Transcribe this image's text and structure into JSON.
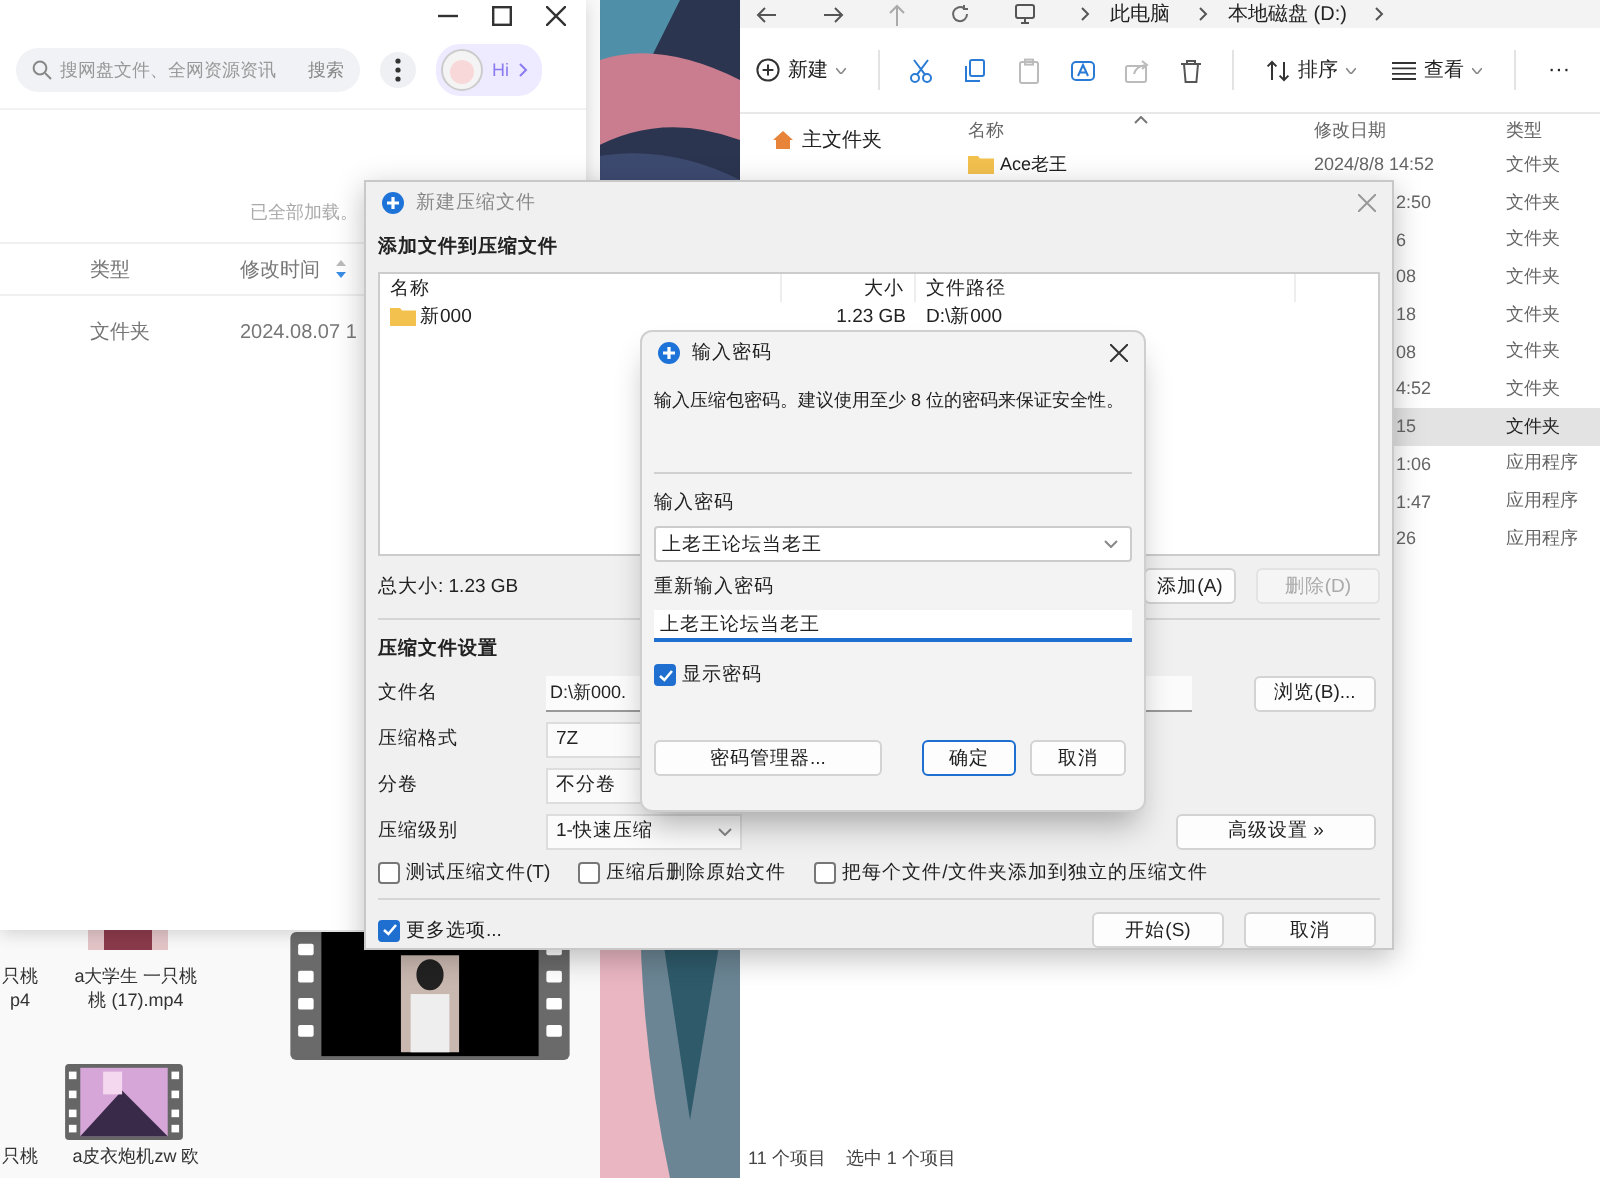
{
  "cloud_app": {
    "search": {
      "placeholder": "搜网盘文件、全网资源资讯",
      "button": "搜索"
    },
    "assistant_label": "Hi",
    "load_status": "已全部加载。",
    "columns": [
      "类型",
      "修改时间"
    ],
    "rows": [
      {
        "type": "文件夹",
        "modified": "2024.08.07 1"
      }
    ]
  },
  "video_folder": {
    "files": [
      {
        "lines": [
          "只桃",
          "p4"
        ]
      },
      {
        "lines": [
          "a大学生 一只桃",
          "桃 (17).mp4"
        ]
      },
      {
        "lines": [
          "只桃"
        ]
      },
      {
        "lines": [
          "a皮衣炮机zw 欧"
        ]
      }
    ]
  },
  "explorer": {
    "breadcrumb": [
      "此电脑",
      "本地磁盘 (D:)"
    ],
    "toolbar": {
      "new": "新建",
      "sort": "排序",
      "view": "查看",
      "more": "···"
    },
    "tools": [
      {
        "kind": "cut",
        "disabled": false
      },
      {
        "kind": "copy",
        "disabled": false
      },
      {
        "kind": "paste",
        "disabled": true
      },
      {
        "kind": "rename",
        "disabled": false
      },
      {
        "kind": "share",
        "disabled": true
      },
      {
        "kind": "delete",
        "disabled": false
      }
    ],
    "sidebar": [
      "主文件夹"
    ],
    "columns": [
      "名称",
      "修改日期",
      "类型"
    ],
    "rows": [
      {
        "name": "Ace老王",
        "modified": "2024/8/8 14:52",
        "type": "文件夹",
        "selected": false
      },
      {
        "modified": "2:50",
        "type": "文件夹",
        "selected": false
      },
      {
        "modified": "6",
        "type": "文件夹",
        "selected": false
      },
      {
        "modified": "08",
        "type": "文件夹",
        "selected": false
      },
      {
        "modified": "18",
        "type": "文件夹",
        "selected": false
      },
      {
        "modified": "08",
        "type": "文件夹",
        "selected": false
      },
      {
        "modified": "4:52",
        "type": "文件夹",
        "selected": false
      },
      {
        "modified": "15",
        "type": "文件夹",
        "selected": true
      },
      {
        "modified": "1:06",
        "type": "应用程序",
        "selected": false
      },
      {
        "modified": "1:47",
        "type": "应用程序",
        "selected": false
      },
      {
        "modified": "26",
        "type": "应用程序",
        "selected": false
      }
    ],
    "status": [
      "11 个项目",
      "选中 1 个项目"
    ]
  },
  "archive_dialog": {
    "title": "新建压缩文件",
    "heading": "添加文件到压缩文件",
    "list": {
      "columns": [
        "名称",
        "大小",
        "文件路径"
      ],
      "rows": [
        {
          "name": "新000",
          "size": "1.23 GB",
          "path": "D:\\新000"
        }
      ]
    },
    "total": "总大小: 1.23 GB",
    "list_buttons": [
      {
        "label": "添加(A)",
        "disabled": false
      },
      {
        "label": "删除(D)",
        "disabled": true
      }
    ],
    "settings_heading": "压缩文件设置",
    "fields": [
      {
        "label": "文件名",
        "value": "D:\\新000.",
        "kind": "text"
      },
      {
        "label": "压缩格式",
        "value": "7Z",
        "kind": "short"
      },
      {
        "label": "分卷",
        "value": "不分卷",
        "kind": "short"
      },
      {
        "label": "压缩级别",
        "value": "1-快速压缩",
        "kind": "select"
      }
    ],
    "browse_button": "浏览(B)...",
    "advanced_button": "高级设置 »",
    "options": [
      {
        "label": "测试压缩文件(T)",
        "checked": false
      },
      {
        "label": "压缩后删除原始文件",
        "checked": false
      },
      {
        "label": "把每个文件/文件夹添加到独立的压缩文件",
        "checked": false
      }
    ],
    "more_options": {
      "label": "更多选项...",
      "checked": true
    },
    "buttons": [
      "开始(S)",
      "取消"
    ]
  },
  "password_dialog": {
    "title": "输入密码",
    "hint": "输入压缩包密码。建议使用至少 8 位的密码来保证安全性。",
    "password_label": "输入密码",
    "password": "上老王论坛当老王",
    "confirm_label": "重新输入密码",
    "confirm": "上老王论坛当老王",
    "show_password": {
      "label": "显示密码",
      "checked": true
    },
    "buttons": [
      {
        "label": "密码管理器...",
        "default": false
      },
      {
        "label": "确定",
        "default": true
      },
      {
        "label": "取消",
        "default": false
      }
    ]
  }
}
